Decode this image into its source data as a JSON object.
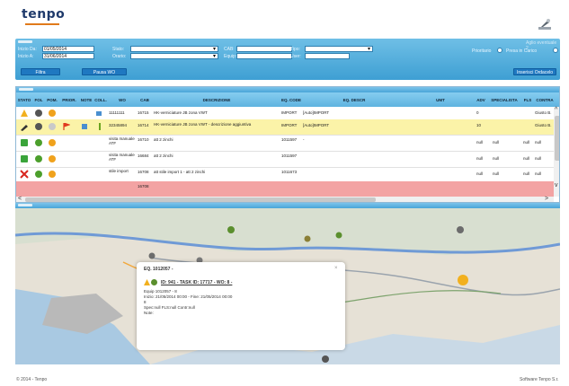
{
  "app": {
    "logo_text": "tenpo",
    "footer_left": "© 2014 - Tenpo",
    "footer_right": "Software Tenpo S.r."
  },
  "filters": {
    "inizio_da_label": "Inizio Da:",
    "inizio_da_value": "01/05/2014",
    "inizio_a_label": "Inizio A:",
    "inizio_a_value": "31/06/2014",
    "stato_label": "Stato:",
    "orario_label": "Orario:",
    "cab_label": "CAB:",
    "equip_label": "Equip:",
    "tipo_label": "Tipo:",
    "user_label": "User:",
    "right_note": "Aglio eventuale 2",
    "prioritario_label": "Prioritario",
    "presa_in_carico_label": "Presa in Carico",
    "filtra_label": "Filtra",
    "pausa_label": "Pausa WO",
    "inserisci_label": "Inserisci Ordacelo"
  },
  "grid": {
    "columns": [
      "STATO",
      "FOL",
      "POM.",
      "PRIOR.",
      "NOTE",
      "COLL.",
      "WO",
      "CAB",
      "DESCRIZIONE",
      "EQ. CODE",
      "EQ. DESCR",
      "UMT",
      "ADV",
      "SPECIALISTA",
      "FLS",
      "CONTRA"
    ],
    "rows": [
      {
        "wo": "11111111",
        "cab": "16715",
        "descr": "HK-verniciature JB zona VWT",
        "eq_code": "IMPORT",
        "eq_descr": "[Auto]IMPORT",
        "adv": "0",
        "spec": "",
        "fls": "",
        "contra": "Giusto B."
      },
      {
        "wo": "32345894",
        "cab": "16714",
        "descr": "HK-verniciature JB zona VWT - descrizione aggiuntiva",
        "eq_code": "IMPORT",
        "eq_descr": "[Auto]IMPORT",
        "adv": "10",
        "spec": "",
        "fls": "",
        "contra": "Giusto B."
      },
      {
        "wo": "visita manuale ATF",
        "cab": "16710",
        "descr": "att 2 zinchi",
        "eq_code": "1011597",
        "eq_descr": "-",
        "adv": "null",
        "spec": "null",
        "fls": "null",
        "contra": "null"
      },
      {
        "wo": "visita manuale ATF",
        "cab": "16684",
        "descr": "att 2 zinchi",
        "eq_code": "1011597",
        "eq_descr": "",
        "adv": "null",
        "spec": "null",
        "fls": "null",
        "contra": "null"
      },
      {
        "wo": "stile import",
        "cab": "16708",
        "descr": "att stile import 1 - att 2 zinchi",
        "eq_code": "1011673",
        "eq_descr": "",
        "adv": "null",
        "spec": "null",
        "fls": "null",
        "contra": "null"
      },
      {
        "wo": "",
        "cab": "16708",
        "descr": "",
        "eq_code": "",
        "eq_descr": "",
        "adv": "",
        "spec": "",
        "fls": "",
        "contra": ""
      }
    ]
  },
  "popup": {
    "title": "EQ. 1012057 -",
    "link": "ID: 941 - TASK ID: 17717 - WO: 8 -",
    "line1": "Equip 1012057 - 8",
    "line2": "Inizio: 21/05/2014 00:00 - Fine: 21/05/2014 00:00",
    "line3": "8",
    "line4": "Spec:null FLS:null Contr:null",
    "line5": "Note:"
  },
  "colors": {
    "accent": "#3e9fd3",
    "highlight_row": "#fbf3a8",
    "alert_row": "#f3a3a3",
    "button": "#1f78c1"
  }
}
